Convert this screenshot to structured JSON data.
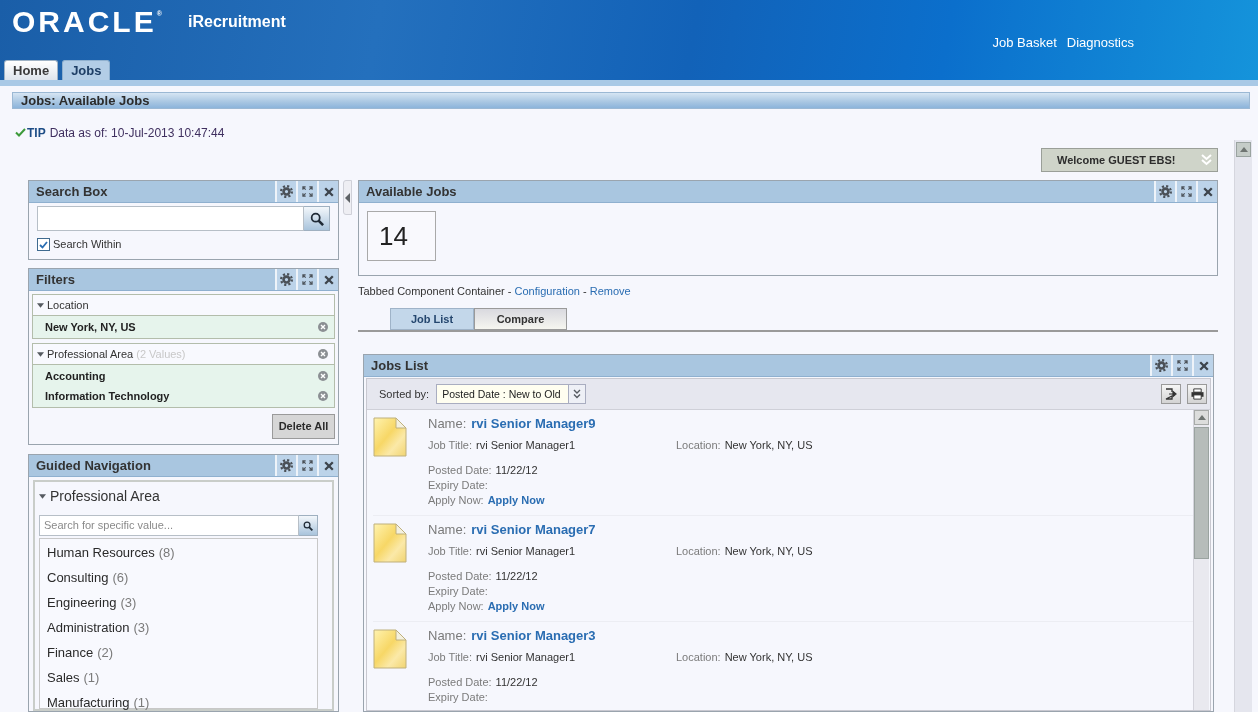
{
  "header": {
    "logo": "ORACLE",
    "logo_mark": "®",
    "app_name": "iRecruitment",
    "links": [
      "Job Basket",
      "Diagnostics"
    ]
  },
  "tabs": [
    {
      "label": "Home",
      "selected": false
    },
    {
      "label": "Jobs",
      "selected": true
    }
  ],
  "page_title": "Jobs: Available Jobs",
  "tip": {
    "label": "TIP",
    "text": "Data as of: 10-Jul-2013 10:47:44"
  },
  "welcome_menu": "Welcome GUEST EBS!",
  "search_box": {
    "title": "Search Box",
    "search_within": {
      "label": "Search Within",
      "checked": true
    }
  },
  "filters": {
    "title": "Filters",
    "groups": [
      {
        "label": "Location",
        "expanded": true,
        "removable": false,
        "values": [
          "New York, NY, US"
        ]
      },
      {
        "label": "Professional Area",
        "note": "(2 Values)",
        "expanded": true,
        "removable": true,
        "values": [
          "Accounting",
          "Information Technology"
        ]
      }
    ],
    "delete_all": "Delete All"
  },
  "guided_navigation": {
    "title": "Guided Navigation",
    "section": "Professional Area",
    "expanded": true,
    "search": {
      "placeholder": "Search for specific value..."
    },
    "items": [
      {
        "label": "Human Resources",
        "count": "(8)"
      },
      {
        "label": "Consulting",
        "count": "(6)"
      },
      {
        "label": "Engineering",
        "count": "(3)"
      },
      {
        "label": "Administration",
        "count": "(3)"
      },
      {
        "label": "Finance",
        "count": "(2)"
      },
      {
        "label": "Sales",
        "count": "(1)"
      },
      {
        "label": "Manufacturing",
        "count": "(1)"
      }
    ]
  },
  "available_jobs": {
    "title": "Available Jobs",
    "count": "14"
  },
  "container_caption": [
    {
      "kind": "text",
      "text": "Tabbed Component Container - "
    },
    {
      "kind": "link",
      "text": "Configuration"
    },
    {
      "kind": "text",
      "text": " - "
    },
    {
      "kind": "link",
      "text": "Remove"
    }
  ],
  "content_tabs": [
    {
      "label": "Job List",
      "selected": true
    },
    {
      "label": "Compare",
      "selected": false
    }
  ],
  "jobs_list": {
    "title": "Jobs List",
    "sort": {
      "label": "Sorted by:",
      "value": "Posted Date : New to Old"
    },
    "jobs": [
      {
        "name": {
          "label": "Name:",
          "value": "rvi Senior Manager9"
        },
        "job_title": {
          "label": "Job Title:",
          "value": "rvi Senior Manager1"
        },
        "location": {
          "label": "Location:",
          "value": "New York, NY, US"
        },
        "posted_date": {
          "label": "Posted Date:",
          "value": "11/22/12"
        },
        "expiry_date": {
          "label": "Expiry Date:"
        },
        "apply_now": {
          "label": "Apply Now:",
          "link": "Apply Now"
        }
      },
      {
        "name": {
          "label": "Name:",
          "value": "rvi Senior Manager7"
        },
        "job_title": {
          "label": "Job Title:",
          "value": "rvi Senior Manager1"
        },
        "location": {
          "label": "Location:",
          "value": "New York, NY, US"
        },
        "posted_date": {
          "label": "Posted Date:",
          "value": "11/22/12"
        },
        "expiry_date": {
          "label": "Expiry Date:"
        },
        "apply_now": {
          "label": "Apply Now:",
          "link": "Apply Now"
        }
      },
      {
        "name": {
          "label": "Name:",
          "value": "rvi Senior Manager3"
        },
        "job_title": {
          "label": "Job Title:",
          "value": "rvi Senior Manager1"
        },
        "location": {
          "label": "Location:",
          "value": "New York, NY, US"
        },
        "posted_date": {
          "label": "Posted Date:",
          "value": "11/22/12"
        },
        "expiry_date": {
          "label": "Expiry Date:"
        }
      }
    ]
  }
}
